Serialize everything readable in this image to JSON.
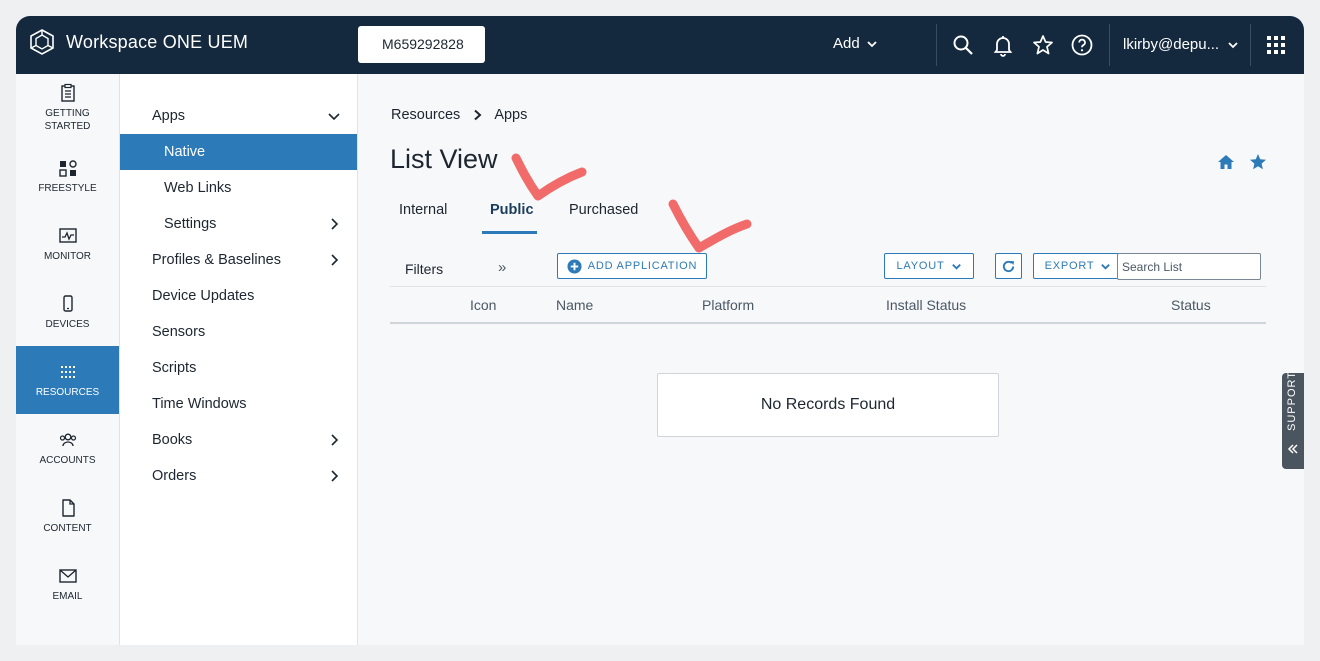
{
  "header": {
    "brand": "Workspace ONE UEM",
    "org_group": "M659292828",
    "add_label": "Add",
    "user": "lkirby@depu..."
  },
  "leftnav": {
    "items": [
      {
        "label": "GETTING STARTED",
        "icon": "clipboard-icon"
      },
      {
        "label": "FREESTYLE",
        "icon": "freestyle-icon"
      },
      {
        "label": "MONITOR",
        "icon": "monitor-icon"
      },
      {
        "label": "DEVICES",
        "icon": "device-icon"
      },
      {
        "label": "RESOURCES",
        "icon": "resources-icon",
        "active": true
      },
      {
        "label": "ACCOUNTS",
        "icon": "accounts-icon"
      },
      {
        "label": "CONTENT",
        "icon": "content-icon"
      },
      {
        "label": "EMAIL",
        "icon": "email-icon"
      }
    ]
  },
  "subnav": {
    "items": [
      {
        "label": "Apps",
        "expanded": true
      },
      {
        "label": "Native",
        "active": true
      },
      {
        "label": "Web Links"
      },
      {
        "label": "Settings"
      },
      {
        "label": "Profiles & Baselines"
      },
      {
        "label": "Device Updates"
      },
      {
        "label": "Sensors"
      },
      {
        "label": "Scripts"
      },
      {
        "label": "Time Windows"
      },
      {
        "label": "Books"
      },
      {
        "label": "Orders"
      }
    ]
  },
  "breadcrumb": {
    "root": "Resources",
    "current": "Apps"
  },
  "page": {
    "title": "List View"
  },
  "tabs": [
    {
      "label": "Internal"
    },
    {
      "label": "Public",
      "active": true
    },
    {
      "label": "Purchased"
    }
  ],
  "toolbar": {
    "filters": "Filters",
    "add_application": "ADD APPLICATION",
    "layout": "LAYOUT",
    "export": "EXPORT",
    "search_placeholder": "Search List"
  },
  "table": {
    "columns": [
      "Icon",
      "Name",
      "Platform",
      "Install Status",
      "Status"
    ],
    "empty_message": "No Records Found"
  },
  "support": {
    "label": "SUPPORT"
  },
  "colors": {
    "header_bg": "#14293d",
    "accent": "#2d7ab8",
    "annotation": "#f26b6b"
  }
}
